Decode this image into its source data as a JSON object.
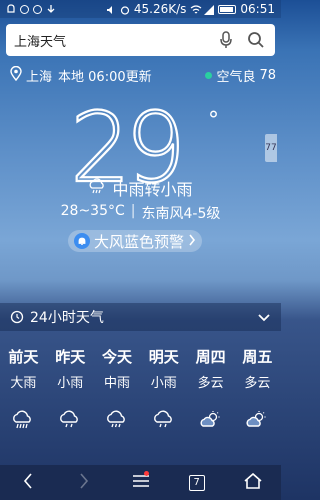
{
  "status_bar": {
    "network_speed": "45.26K/s",
    "time": "06:51"
  },
  "search": {
    "query": "上海天气"
  },
  "location": {
    "city": "上海",
    "update_text": "本地 06:00更新",
    "air_quality_label": "空气良",
    "air_quality_value": "78"
  },
  "current": {
    "temperature": "29",
    "degree_symbol": "°",
    "condition": "中雨转小雨",
    "temp_range": "28~35°C",
    "wind": "东南风4-5级",
    "warning": "大风蓝色预警"
  },
  "side_tab": {
    "label": "77"
  },
  "hourly": {
    "title": "24小时天气"
  },
  "forecast": [
    {
      "day": "前天",
      "cond": "大雨",
      "icon": "heavy-rain-icon"
    },
    {
      "day": "昨天",
      "cond": "小雨",
      "icon": "light-rain-icon"
    },
    {
      "day": "今天",
      "cond": "中雨",
      "icon": "moderate-rain-icon"
    },
    {
      "day": "明天",
      "cond": "小雨",
      "icon": "light-rain-icon"
    },
    {
      "day": "周四",
      "cond": "多云",
      "icon": "partly-cloudy-icon"
    },
    {
      "day": "周五",
      "cond": "多云",
      "icon": "partly-cloudy-icon"
    }
  ],
  "nav": {
    "tab_count": "7"
  }
}
